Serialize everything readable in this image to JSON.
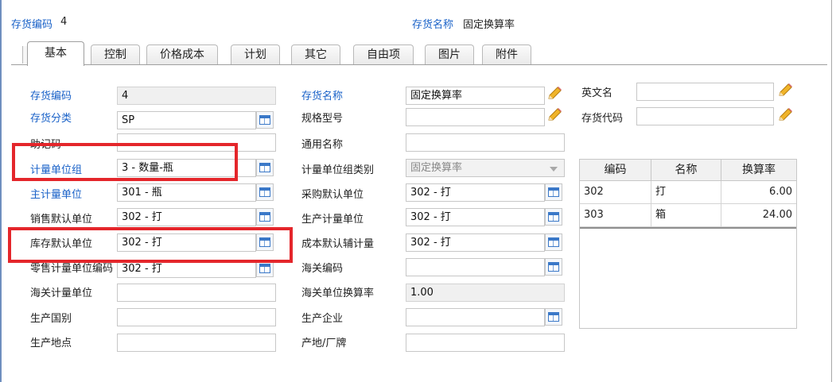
{
  "header": {
    "code_label": "存货编码",
    "code_value": "4",
    "name_label": "存货名称",
    "name_value": "固定换算率"
  },
  "tabs": [
    "基本",
    "控制",
    "价格成本",
    "计划",
    "其它",
    "自由项",
    "图片",
    "附件"
  ],
  "active_tab": "基本",
  "col1": {
    "inventory_code": {
      "label": "存货编码",
      "value": "4"
    },
    "inventory_class": {
      "label": "存货分类",
      "value": "SP"
    },
    "mnemonic": {
      "label": "助记码",
      "value": ""
    },
    "unit_group": {
      "label": "计量单位组",
      "value": "3 - 数量-瓶"
    },
    "main_unit": {
      "label": "主计量单位",
      "value": "301 - 瓶"
    },
    "sales_unit": {
      "label": "销售默认单位",
      "value": "302 - 打"
    },
    "stock_unit": {
      "label": "库存默认单位",
      "value": "302 - 打"
    },
    "retail_unit": {
      "label": "零售计量单位编码",
      "value": "302 - 打"
    },
    "customs_unit": {
      "label": "海关计量单位",
      "value": ""
    },
    "origin_country": {
      "label": "生产国别",
      "value": ""
    },
    "origin_place": {
      "label": "生产地点",
      "value": ""
    }
  },
  "col2": {
    "inventory_name": {
      "label": "存货名称",
      "value": "固定换算率"
    },
    "spec_model": {
      "label": "规格型号",
      "value": ""
    },
    "common_name": {
      "label": "通用名称",
      "value": ""
    },
    "unit_group_type": {
      "label": "计量单位组类别",
      "value": "固定换算率"
    },
    "purchase_unit": {
      "label": "采购默认单位",
      "value": "302 - 打"
    },
    "production_unit": {
      "label": "生产计量单位",
      "value": "302 - 打"
    },
    "cost_aux_unit": {
      "label": "成本默认辅计量",
      "value": "302 - 打"
    },
    "customs_code": {
      "label": "海关编码",
      "value": ""
    },
    "customs_rate": {
      "label": "海关单位换算率",
      "value": "1.00"
    },
    "manufacturer": {
      "label": "生产企业",
      "value": ""
    },
    "brand": {
      "label": "产地/厂牌",
      "value": ""
    }
  },
  "col3": {
    "english_name": {
      "label": "英文名",
      "value": ""
    },
    "inventory_alias": {
      "label": "存货代码",
      "value": ""
    }
  },
  "unit_table": {
    "headers": [
      "编码",
      "名称",
      "换算率"
    ],
    "rows": [
      [
        "302",
        "打",
        "6.00"
      ],
      [
        "303",
        "箱",
        "24.00"
      ]
    ]
  },
  "icons": {
    "reference": "grid-lookup-icon",
    "edit": "pencil-icon",
    "dropdown": "chevron-down-icon"
  },
  "colors": {
    "label_blue": "#1a62c8",
    "highlight_red": "#e4262b"
  }
}
